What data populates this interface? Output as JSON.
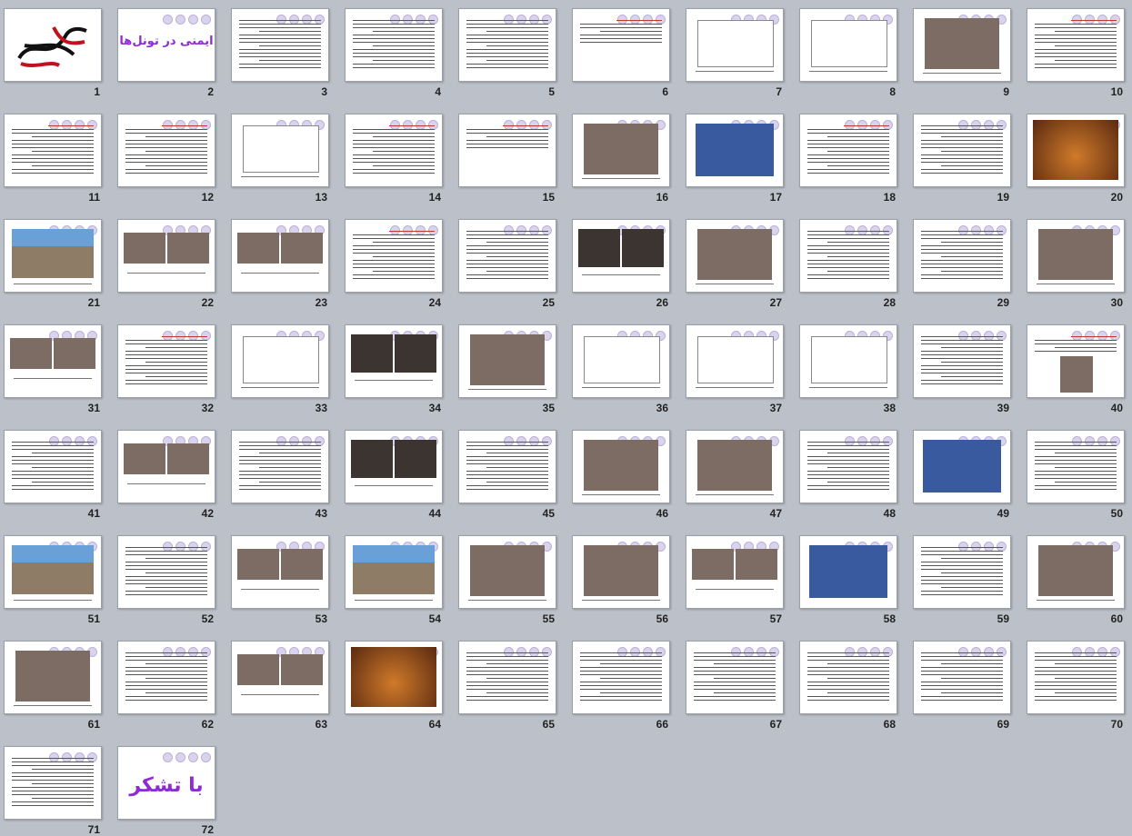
{
  "view": "slide-sorter",
  "slides": [
    {
      "num": "1",
      "type": "logo"
    },
    {
      "num": "2",
      "type": "title",
      "title": "ایمنی در تونل‌ها"
    },
    {
      "num": "3",
      "type": "text"
    },
    {
      "num": "4",
      "type": "text"
    },
    {
      "num": "5",
      "type": "text"
    },
    {
      "num": "6",
      "type": "text-short"
    },
    {
      "num": "7",
      "type": "drawing"
    },
    {
      "num": "8",
      "type": "drawing"
    },
    {
      "num": "9",
      "type": "photo"
    },
    {
      "num": "10",
      "type": "text-red"
    },
    {
      "num": "11",
      "type": "text-red"
    },
    {
      "num": "12",
      "type": "text-red"
    },
    {
      "num": "13",
      "type": "drawing"
    },
    {
      "num": "14",
      "type": "text-red"
    },
    {
      "num": "15",
      "type": "text-short"
    },
    {
      "num": "16",
      "type": "photo"
    },
    {
      "num": "17",
      "type": "photo-blue"
    },
    {
      "num": "18",
      "type": "text-red"
    },
    {
      "num": "19",
      "type": "text"
    },
    {
      "num": "20",
      "type": "photo-rust"
    },
    {
      "num": "21",
      "type": "photo-sky"
    },
    {
      "num": "22",
      "type": "photo-two"
    },
    {
      "num": "23",
      "type": "photo-two"
    },
    {
      "num": "24",
      "type": "text-red"
    },
    {
      "num": "25",
      "type": "text"
    },
    {
      "num": "26",
      "type": "photo-dark"
    },
    {
      "num": "27",
      "type": "photo"
    },
    {
      "num": "28",
      "type": "text"
    },
    {
      "num": "29",
      "type": "text"
    },
    {
      "num": "30",
      "type": "photo"
    },
    {
      "num": "31",
      "type": "photo-two"
    },
    {
      "num": "32",
      "type": "text-red"
    },
    {
      "num": "33",
      "type": "drawing"
    },
    {
      "num": "34",
      "type": "photo-dark"
    },
    {
      "num": "35",
      "type": "photo"
    },
    {
      "num": "36",
      "type": "drawing"
    },
    {
      "num": "37",
      "type": "drawing"
    },
    {
      "num": "38",
      "type": "drawing"
    },
    {
      "num": "39",
      "type": "text"
    },
    {
      "num": "40",
      "type": "text-photo"
    },
    {
      "num": "41",
      "type": "text"
    },
    {
      "num": "42",
      "type": "photo-two"
    },
    {
      "num": "43",
      "type": "text"
    },
    {
      "num": "44",
      "type": "photo-dark"
    },
    {
      "num": "45",
      "type": "text"
    },
    {
      "num": "46",
      "type": "photo"
    },
    {
      "num": "47",
      "type": "photo"
    },
    {
      "num": "48",
      "type": "text"
    },
    {
      "num": "49",
      "type": "photo-blue"
    },
    {
      "num": "50",
      "type": "text"
    },
    {
      "num": "51",
      "type": "photo-sky"
    },
    {
      "num": "52",
      "type": "text"
    },
    {
      "num": "53",
      "type": "photo-two"
    },
    {
      "num": "54",
      "type": "photo-sky"
    },
    {
      "num": "55",
      "type": "photo"
    },
    {
      "num": "56",
      "type": "photo"
    },
    {
      "num": "57",
      "type": "photo-two"
    },
    {
      "num": "58",
      "type": "photo-blue"
    },
    {
      "num": "59",
      "type": "text"
    },
    {
      "num": "60",
      "type": "photo"
    },
    {
      "num": "61",
      "type": "photo"
    },
    {
      "num": "62",
      "type": "text"
    },
    {
      "num": "63",
      "type": "photo-two"
    },
    {
      "num": "64",
      "type": "photo-rust"
    },
    {
      "num": "65",
      "type": "text"
    },
    {
      "num": "66",
      "type": "text"
    },
    {
      "num": "67",
      "type": "text"
    },
    {
      "num": "68",
      "type": "text"
    },
    {
      "num": "69",
      "type": "text"
    },
    {
      "num": "70",
      "type": "text"
    },
    {
      "num": "71",
      "type": "text"
    },
    {
      "num": "72",
      "type": "title",
      "title": "با تشکر"
    }
  ]
}
